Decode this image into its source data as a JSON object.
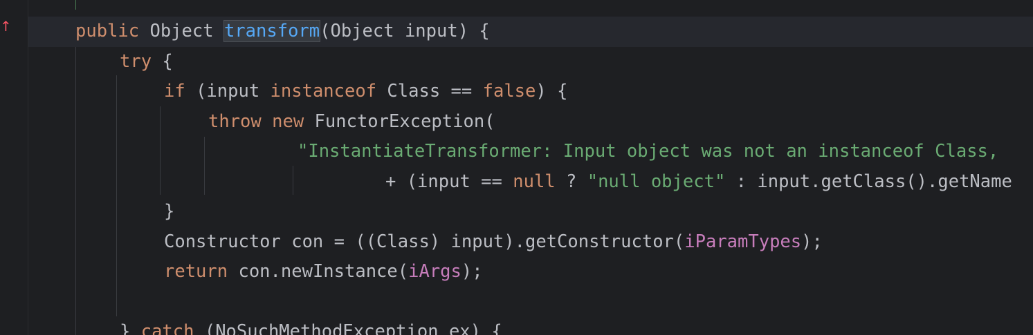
{
  "editor": {
    "colors": {
      "background": "#1e1f22",
      "current_line": "#26282e",
      "keyword": "#cf8e6d",
      "string": "#6aab73",
      "field": "#c77dbb",
      "method_declaration": "#56a8f5",
      "default_text": "#bcbec4",
      "override_marker": "#f75464"
    },
    "gutter": {
      "override_icon": "override-method-icon",
      "override_glyph": "↑"
    },
    "lines": [
      {
        "tokens": []
      },
      {
        "current": true,
        "tokens": [
          {
            "t": "public",
            "c": "kw"
          },
          {
            "t": " Object ",
            "c": "plain"
          },
          {
            "t": "transform",
            "c": "fn",
            "hl": true
          },
          {
            "t": "(Object input) {",
            "c": "plain"
          }
        ]
      },
      {
        "tokens": [
          {
            "t": "try",
            "c": "kw"
          },
          {
            "t": " {",
            "c": "plain"
          }
        ]
      },
      {
        "tokens": [
          {
            "t": "if",
            "c": "kw"
          },
          {
            "t": " (input ",
            "c": "plain"
          },
          {
            "t": "instanceof",
            "c": "kw"
          },
          {
            "t": " Class == ",
            "c": "plain"
          },
          {
            "t": "false",
            "c": "kw"
          },
          {
            "t": ") {",
            "c": "plain"
          }
        ]
      },
      {
        "tokens": [
          {
            "t": "throw",
            "c": "kw"
          },
          {
            "t": " ",
            "c": "plain"
          },
          {
            "t": "new",
            "c": "kw"
          },
          {
            "t": " FunctorException(",
            "c": "plain"
          }
        ]
      },
      {
        "tokens": [
          {
            "t": "\"InstantiateTransformer: Input object was not an instanceof Class,",
            "c": "str"
          }
        ]
      },
      {
        "tokens": [
          {
            "t": "+ (input == ",
            "c": "plain"
          },
          {
            "t": "null",
            "c": "kw"
          },
          {
            "t": " ? ",
            "c": "plain"
          },
          {
            "t": "\"null object\"",
            "c": "str"
          },
          {
            "t": " : input.getClass().getName",
            "c": "plain"
          }
        ]
      },
      {
        "tokens": [
          {
            "t": "}",
            "c": "plain"
          }
        ]
      },
      {
        "tokens": [
          {
            "t": "Constructor con = ((Class) input).getConstructor(",
            "c": "plain"
          },
          {
            "t": "iParamTypes",
            "c": "fld"
          },
          {
            "t": ");",
            "c": "plain"
          }
        ]
      },
      {
        "tokens": [
          {
            "t": "return",
            "c": "kw"
          },
          {
            "t": " con.newInstance(",
            "c": "plain"
          },
          {
            "t": "iArgs",
            "c": "fld"
          },
          {
            "t": ");",
            "c": "plain"
          }
        ]
      },
      {
        "tokens": []
      },
      {
        "tokens": [
          {
            "t": "} ",
            "c": "plain"
          },
          {
            "t": "catch",
            "c": "kw"
          },
          {
            "t": " (NoSuchMethodException ex) {",
            "c": "plain"
          }
        ]
      }
    ]
  }
}
